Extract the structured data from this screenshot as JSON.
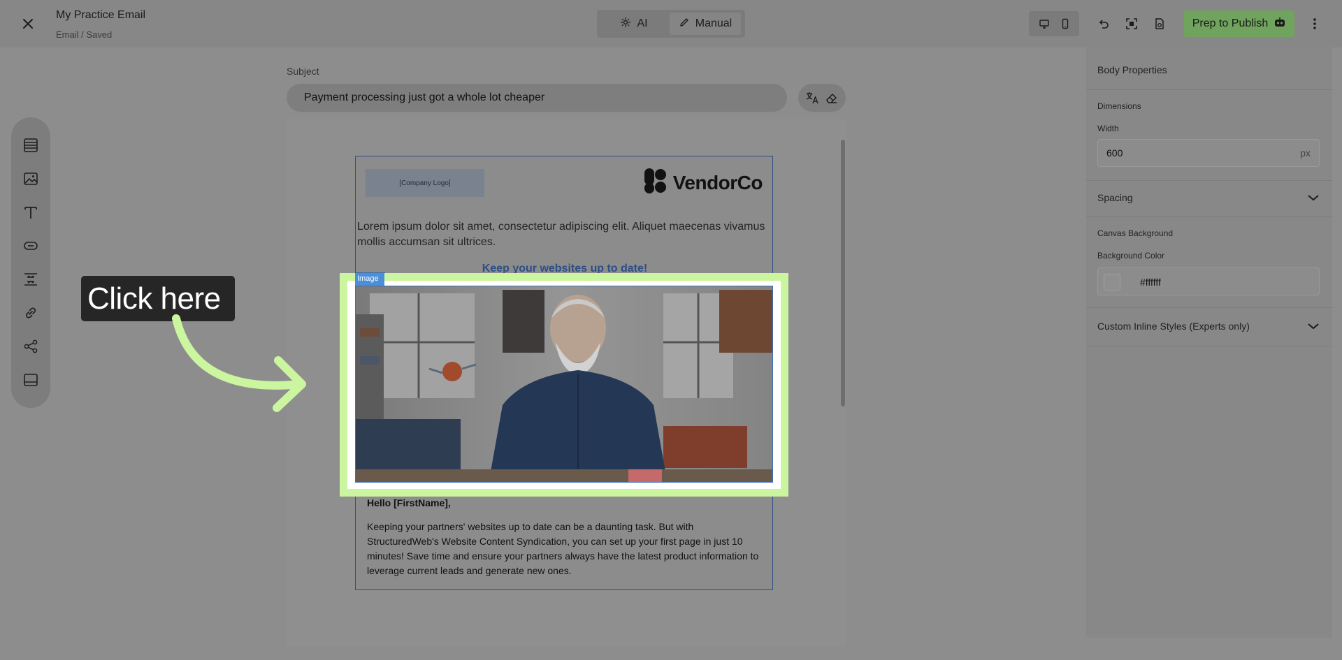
{
  "header": {
    "title": "My Practice Email",
    "status": "Email / Saved",
    "modes": {
      "ai": "AI",
      "manual": "Manual"
    },
    "publish_label": "Prep to Publish"
  },
  "subject": {
    "label": "Subject",
    "value": "Payment processing just got a whole lot cheaper"
  },
  "email": {
    "logo_placeholder": "[Company Logo]",
    "brand_name": "VendorCo",
    "lorem": "Lorem ipsum dolor sit amet, consectetur adipiscing elit. Aliquet maecenas vivamus mollis accumsan sit ultrices.",
    "section_heading": "Keep your websites up to date!",
    "image_tag": "Image",
    "greeting": "Hello [FirstName],",
    "paragraph": "Keeping your partners' websites up to date can be a daunting task. But with StructuredWeb's Website Content Syndication, you can set up your first page in just 10 minutes! Save time and ensure your partners always have the latest product information to leverage current leads and generate new ones."
  },
  "callout": {
    "text": "Click here"
  },
  "panel": {
    "title": "Body Properties",
    "dimensions_label": "Dimensions",
    "width_label": "Width",
    "width_value": "600",
    "width_unit": "px",
    "spacing_label": "Spacing",
    "canvas_bg_label": "Canvas Background",
    "bg_color_label": "Background Color",
    "bg_color_value": "#ffffff",
    "custom_styles_label": "Custom Inline Styles (Experts only)"
  },
  "colors": {
    "highlight": "#ccf5a0",
    "publish": "#6fa35e",
    "accent_blue": "#4a8fd9"
  }
}
